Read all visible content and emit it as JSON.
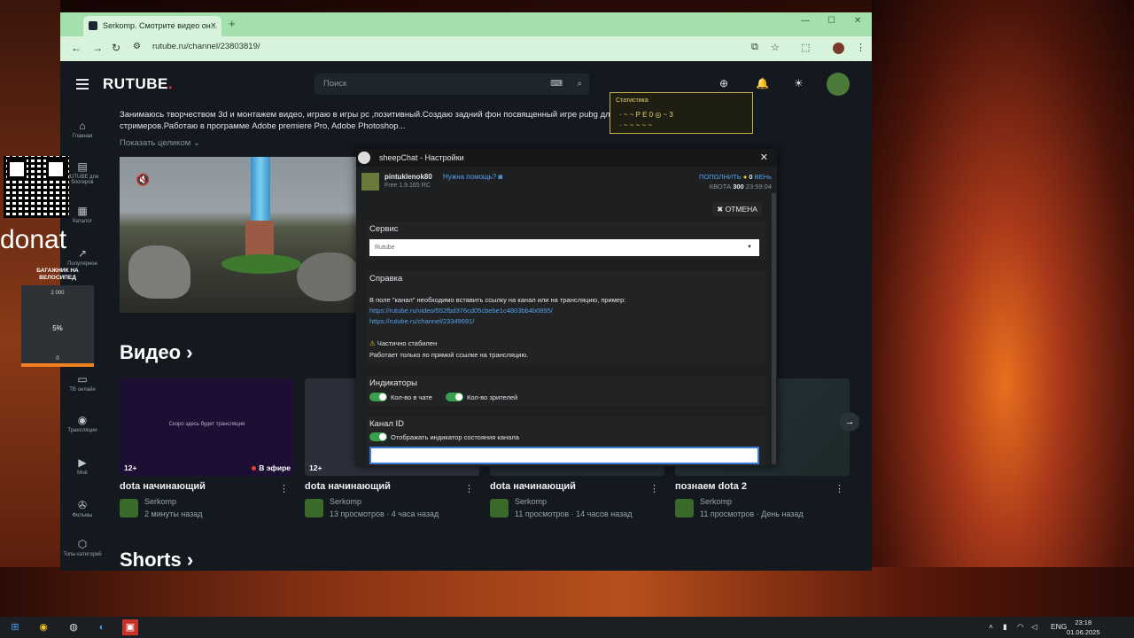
{
  "browser": {
    "tab_title": "Serkomp. Смотрите видео он...",
    "url": "rutube.ru/channel/23803819/"
  },
  "rutube": {
    "logo": "RUTUBE",
    "search_placeholder": "Поиск",
    "sidebar": [
      {
        "icon": "home-icon",
        "label": "Главная"
      },
      {
        "icon": "doc-icon",
        "label": "RUTUBE для блогеров"
      },
      {
        "icon": "catalog-icon",
        "label": "Каталог"
      },
      {
        "icon": "popular-icon",
        "label": "Популярное"
      },
      {
        "icon": "tv-icon",
        "label": "ТВ онлайн"
      },
      {
        "icon": "broadcast-icon",
        "label": "Трансляции"
      },
      {
        "icon": "my-icon",
        "label": "Моё"
      },
      {
        "icon": "films-icon",
        "label": "Фильмы"
      },
      {
        "icon": "tops-icon",
        "label": "Топы категорий"
      }
    ],
    "channel_desc": "Занимаюсь творчеством 3d и монтажем видео, играю в игры pc ,позитивный.Создаю задний фон посвященный игре pubg для стримеров.Работаю в программе Adobe premiere Pro, Adobe Photoshop...",
    "show_all": "Показать целиком",
    "videos_title": "Видео",
    "shorts_title": "Shorts",
    "cards": [
      {
        "title": "dota начинающий",
        "channel": "Serkomp",
        "info": "2 минуты назад",
        "age": "12+",
        "live": "В эфире",
        "thumb_text": "Скоро здесь будет трансляция"
      },
      {
        "title": "dota начинающий",
        "channel": "Serkomp",
        "info": "13 просмотров · 4 часа назад",
        "age": "12+"
      },
      {
        "title": "dota начинающий",
        "channel": "Serkomp",
        "info": "11 просмотров · 14 часов назад"
      },
      {
        "title": "познаем dota 2",
        "channel": "Serkomp",
        "info": "11 просмотров · День назад"
      }
    ]
  },
  "overlay": {
    "donat": "donat",
    "goal_title": "БАГАЖНИК НА ВЕЛОСИПЕД",
    "goal_top": "2 000",
    "goal_pct": "5%",
    "goal_progress": 0.05,
    "goal_bottom": "0",
    "stats_title": "Статистика",
    "stats_line1": "· ~ ~ P E 0 ◎ ~ 3",
    "stats_line2": "· ~ ~ ~ ~ ~"
  },
  "dialog": {
    "title": "sheepChat - Настройки",
    "username": "pintuklenok80",
    "help": "Нужна помощь?",
    "version": "Free 1.9.165 RC",
    "topup_label": "ПОПОЛНИТЬ",
    "balance": "0",
    "balance_unit": "ВЕНь",
    "quota_label": "КВОТА",
    "quota_value": "300",
    "quota_time": "23:59:04",
    "cancel": "ОТМЕНА",
    "service_label": "Сервис",
    "service_value": "Rutube",
    "help_title": "Справка",
    "help_text": "В поле \"канал\" необходимо вставить ссылку на канал или на трансляцию, пример:",
    "help_link1": "https://rutube.ru/video/552fbd376cd05cbebe1c4803bb4b0895/",
    "help_link2": "https://rutube.ru/channel/23349691/",
    "warn": "Частично стабилен",
    "warn_text": "Работает только по прямой ссылке на трансляцию.",
    "indicators_title": "Индикаторы",
    "ind1": "Кол-во в чате",
    "ind2": "Кол-во зрителей",
    "channel_title": "Канал ID",
    "channel_toggle": "Отображать индикатор состояния канала",
    "channel_value": ""
  },
  "taskbar": {
    "lang": "ENG",
    "time": "23:18",
    "date": "01.06.2025"
  }
}
